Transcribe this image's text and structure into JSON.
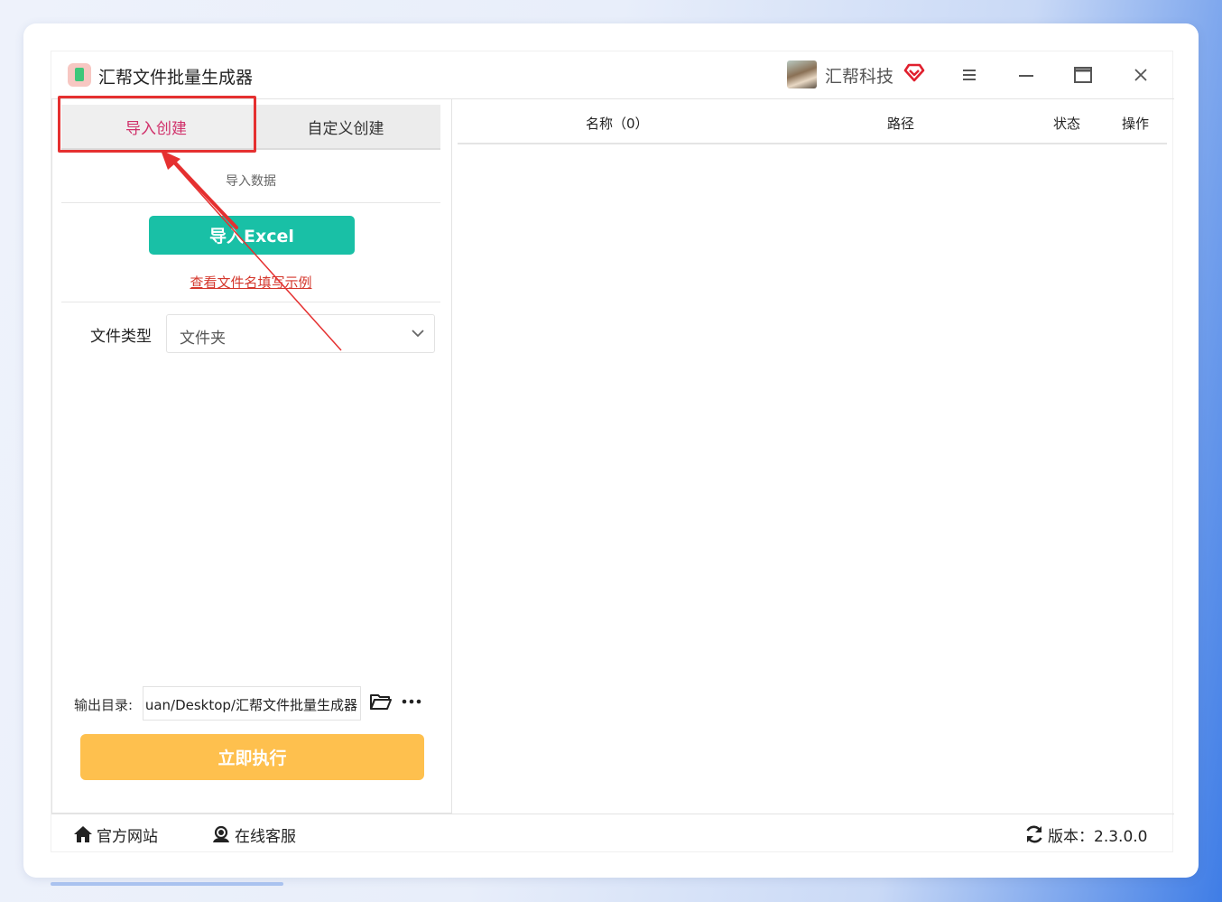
{
  "titlebar": {
    "app_title": "汇帮文件批量生成器",
    "company": "汇帮科技",
    "icons": [
      "app-logo-icon",
      "avatar",
      "vip-heart-icon",
      "menu-icon",
      "minimize-icon",
      "maximize-icon",
      "close-icon"
    ]
  },
  "left_panel": {
    "tabs": [
      {
        "label": "导入创建",
        "active": true
      },
      {
        "label": "自定义创建",
        "active": false
      }
    ],
    "section_label": "导入数据",
    "import_excel_button": "导入Excel",
    "example_link": "查看文件名填写示例",
    "file_type": {
      "label": "文件类型",
      "value": "文件夹"
    },
    "output_dir": {
      "label": "输出目录:",
      "value": "uan/Desktop/汇帮文件批量生成器"
    },
    "execute_button": "立即执行"
  },
  "file_table": {
    "columns": [
      "名称（0）",
      "路径",
      "状态",
      "操作"
    ],
    "rows": []
  },
  "footer": {
    "official_site": "官方网站",
    "online_service": "在线客服",
    "version": "版本：2.3.0.0"
  },
  "colors": {
    "active_tab_text": "#d0306a",
    "excel_button": "#19c0a6",
    "execute_button": "#fec04e",
    "highlight": "#e53030",
    "example_link": "#d4372c"
  }
}
